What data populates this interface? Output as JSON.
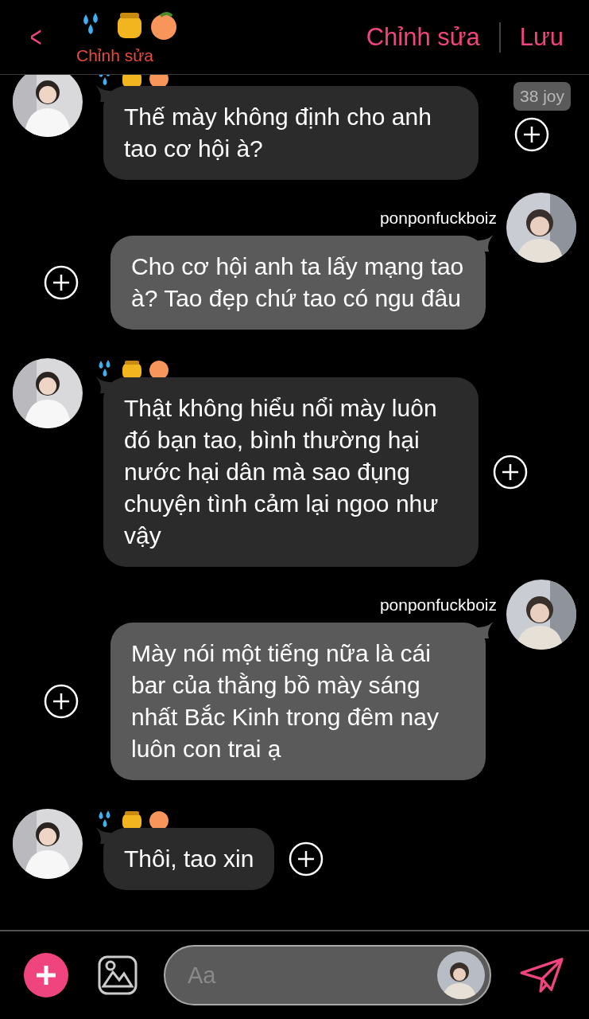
{
  "header": {
    "back": "<",
    "subtitle": "Chỉnh sửa",
    "actions": [
      "Chỉnh sửa",
      "Lưu"
    ]
  },
  "messages": [
    {
      "kind": "incoming",
      "text": "Thế mày không định cho anh tao cơ hội à?",
      "badge": "38 joy"
    },
    {
      "kind": "outgoing",
      "sender": "ponponfuckboiz",
      "text": "Cho cơ hội anh ta lấy mạng tao à? Tao đẹp chứ tao có ngu đâu"
    },
    {
      "kind": "incoming",
      "text": "Thật không hiểu nổi mày luôn đó bạn tao, bình thường hại nước hại dân mà sao đụng chuyện tình cảm lại ngoo như vậy"
    },
    {
      "kind": "outgoing",
      "sender": "ponponfuckboiz",
      "text": "Mày nói một tiếng nữa là cái bar của thằng bồ mày sáng nhất Bắc Kinh trong đêm nay luôn con trai ạ"
    },
    {
      "kind": "incoming",
      "text": "Thôi, tao xin"
    }
  ],
  "composer": {
    "placeholder": "Aa"
  }
}
